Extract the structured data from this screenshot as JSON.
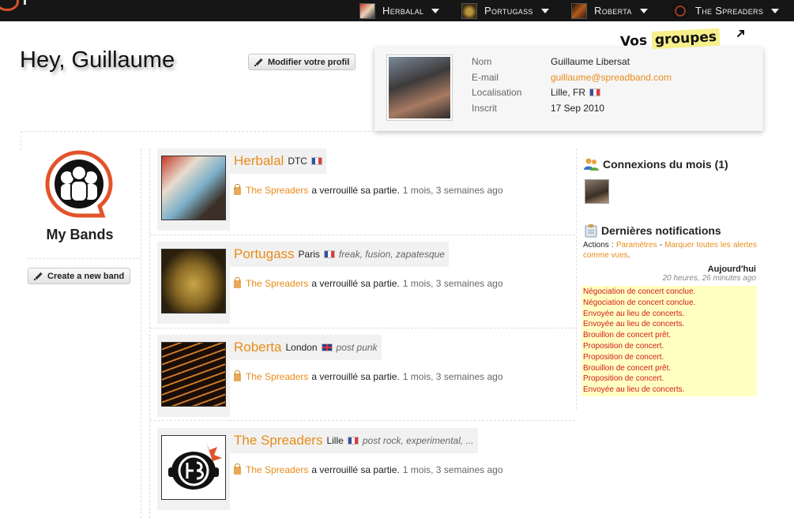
{
  "topbar": {
    "nav": [
      {
        "label": "Herbalal",
        "icon": "band-thumb-herbalal"
      },
      {
        "label": "Portugass",
        "icon": "band-thumb-portugass"
      },
      {
        "label": "Roberta",
        "icon": "band-thumb-roberta"
      },
      {
        "label": "The Spreaders",
        "icon": "band-thumb-spreaders"
      }
    ]
  },
  "greeting": "Hey, Guillaume",
  "edit_profile_label": "Modifier votre profil",
  "profile": {
    "rows": [
      {
        "key": "Nom",
        "value": "Guillaume Libersat"
      },
      {
        "key": "E-mail",
        "value": "guillaume@spreadband.com"
      },
      {
        "key": "Localisation",
        "value": "Lille, FR"
      },
      {
        "key": "Inscrit",
        "value": "17 Sep 2010"
      }
    ]
  },
  "annotation": {
    "vos": "Vos",
    "groupes": "groupes"
  },
  "my_bands": {
    "title": "My Bands",
    "create_label": "Create a new band"
  },
  "bands": [
    {
      "name": "Herbalal",
      "location": "DTC",
      "flag": "fr",
      "tags": "",
      "actor": "The Spreaders",
      "action": "a verrouillé sa partie.",
      "time": "1 mois, 3 semaines ago"
    },
    {
      "name": "Portugass",
      "location": "Paris",
      "flag": "fr",
      "tags": "freak, fusion, zapatesque",
      "actor": "The Spreaders",
      "action": "a verrouillé sa partie.",
      "time": "1 mois, 3 semaines ago"
    },
    {
      "name": "Roberta",
      "location": "London",
      "flag": "uk",
      "tags": "post punk",
      "actor": "The Spreaders",
      "action": "a verrouillé sa partie.",
      "time": "1 mois, 3 semaines ago"
    },
    {
      "name": "The Spreaders",
      "location": "Lille",
      "flag": "fr",
      "tags": "post rock, experimental, ...",
      "actor": "The Spreaders",
      "action": "a verrouillé sa partie.",
      "time": "1 mois, 3 semaines ago"
    }
  ],
  "sidebar": {
    "connections_title": "Connexions du mois (1)",
    "notifications_title": "Dernières notifications",
    "actions_label": "Actions :",
    "params_link": "Paramètres",
    "sep": "-",
    "mark_read_link": "Marquer toutes les alertes comme vues",
    "period": ".",
    "today": "Aujourd'hui",
    "today_time": "20 heures, 26 minutes ago",
    "notifications": [
      "Négociation de concert conclue.",
      "Négociation de concert conclue.",
      "Envoyée au lieu de concerts.",
      "Envoyée au lieu de concerts.",
      "Brouillon de concert prêt.",
      "Proposition de concert.",
      "Proposition de concert.",
      "Brouillon de concert prêt.",
      "Proposition de concert.",
      "Envoyée au lieu de concerts."
    ]
  },
  "colors": {
    "accent": "#e88c1a",
    "topbar": "#161616",
    "notif_text": "#d21b1b",
    "notif_bg": "#ffffc2"
  }
}
